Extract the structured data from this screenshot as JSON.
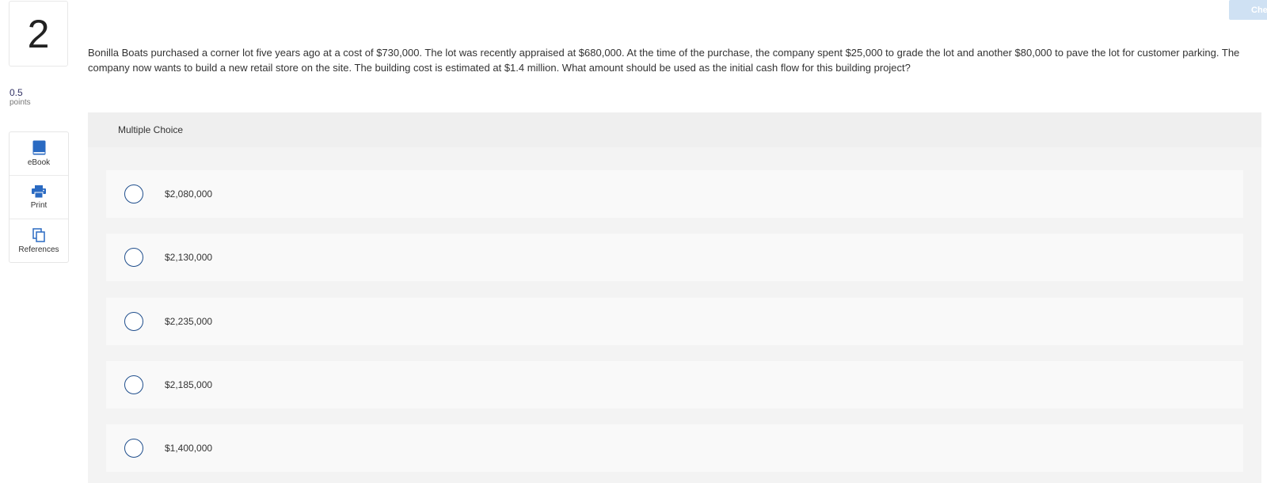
{
  "question": {
    "number": "2",
    "points_value": "0.5",
    "points_label": "points",
    "text": "Bonilla Boats purchased a corner lot five years ago at a cost of $730,000. The lot was recently appraised at $680,000. At the time of the purchase, the company spent $25,000 to grade the lot and another $80,000 to pave the lot for customer parking. The company now wants to build a new retail store on the site. The building cost is estimated at $1.4 million. What amount should be used as the initial cash flow for this building project?"
  },
  "tools": [
    {
      "label": "eBook",
      "icon": "book-icon"
    },
    {
      "label": "Print",
      "icon": "printer-icon"
    },
    {
      "label": "References",
      "icon": "copy-icon"
    }
  ],
  "check_button": {
    "label": "Check"
  },
  "answer_panel": {
    "title": "Multiple Choice",
    "choices": [
      {
        "label": "$2,080,000"
      },
      {
        "label": "$2,130,000"
      },
      {
        "label": "$2,235,000"
      },
      {
        "label": "$2,185,000"
      },
      {
        "label": "$1,400,000"
      }
    ]
  },
  "colors": {
    "accent": "#1f4e8c",
    "icon_blue": "#2a6ac2",
    "check_disabled": "#cfe1f3",
    "panel_bg": "#f3f3f3"
  }
}
